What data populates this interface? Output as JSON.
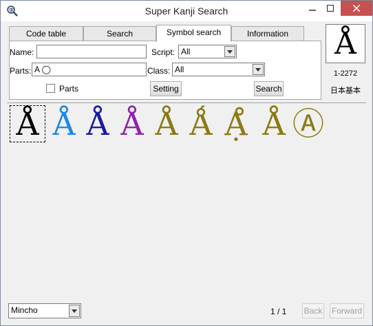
{
  "window": {
    "title": "Super Kanji Search"
  },
  "tabs": [
    {
      "label": "Code table"
    },
    {
      "label": "Search"
    },
    {
      "label": "Symbol search"
    },
    {
      "label": "Information"
    }
  ],
  "form": {
    "name_label": "Name:",
    "name_value": "",
    "script_label": "Script:",
    "script_value": "All",
    "parts_label": "Parts:",
    "parts_value": "A ◯",
    "class_label": "Class:",
    "class_value": "All",
    "parts_checkbox_label": "Parts",
    "parts_checked": false,
    "setting_label": "Setting",
    "search_label": "Search"
  },
  "preview": {
    "glyph": "Å",
    "code": "1-2272",
    "category": "日本基本"
  },
  "results": [
    {
      "glyph": "Å",
      "color": "#000000"
    },
    {
      "glyph": "Å",
      "color": "#1e88e5"
    },
    {
      "glyph": "Å",
      "color": "#1a1aa0"
    },
    {
      "glyph": "Å",
      "color": "#8e24aa"
    },
    {
      "glyph": "Å",
      "color": "#8a7a14"
    },
    {
      "glyph": "Ǻ",
      "color": "#8a7a14"
    },
    {
      "glyph": "Ạ̊",
      "color": "#8a7a14"
    },
    {
      "glyph": "Å",
      "color": "#8a7a14"
    },
    {
      "glyph": "Ⓐ",
      "color": "#8a7a14"
    }
  ],
  "statusbar": {
    "font_value": "Mincho",
    "page": "1 / 1",
    "back_label": "Back",
    "forward_label": "Forward"
  }
}
